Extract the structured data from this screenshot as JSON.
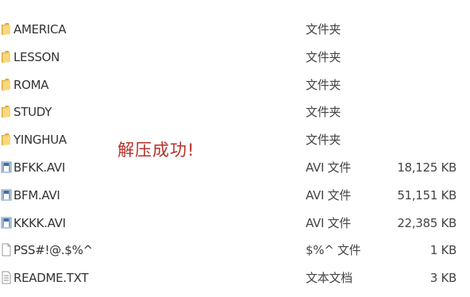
{
  "files": [
    {
      "name": "AMERICA",
      "type": "文件夹",
      "size": "",
      "icon": "folder-icon",
      "kind": "folder"
    },
    {
      "name": "LESSON",
      "type": "文件夹",
      "size": "",
      "icon": "folder-icon",
      "kind": "folder"
    },
    {
      "name": "ROMA",
      "type": "文件夹",
      "size": "",
      "icon": "folder-icon",
      "kind": "folder"
    },
    {
      "name": "STUDY",
      "type": "文件夹",
      "size": "",
      "icon": "folder-icon",
      "kind": "folder"
    },
    {
      "name": "YINGHUA",
      "type": "文件夹",
      "size": "",
      "icon": "folder-icon",
      "kind": "folder"
    },
    {
      "name": "BFKK.AVI",
      "type": "AVI 文件",
      "size": "18,125 KB",
      "icon": "video-file-icon",
      "kind": "video"
    },
    {
      "name": "BFM.AVI",
      "type": "AVI 文件",
      "size": "51,151 KB",
      "icon": "video-file-icon",
      "kind": "video"
    },
    {
      "name": "KKKK.AVI",
      "type": "AVI 文件",
      "size": "22,385 KB",
      "icon": "video-file-icon",
      "kind": "video"
    },
    {
      "name": "PSS#!@.$%^",
      "type": "$%^ 文件",
      "size": "1 KB",
      "icon": "blank-file-icon",
      "kind": "blank"
    },
    {
      "name": "README.TXT",
      "type": "文本文档",
      "size": "3 KB",
      "icon": "text-file-icon",
      "kind": "text"
    }
  ],
  "annotation": "解压成功!",
  "colors": {
    "annotation": "#b5302a",
    "folder": "#e8b84a",
    "text": "#333333"
  }
}
